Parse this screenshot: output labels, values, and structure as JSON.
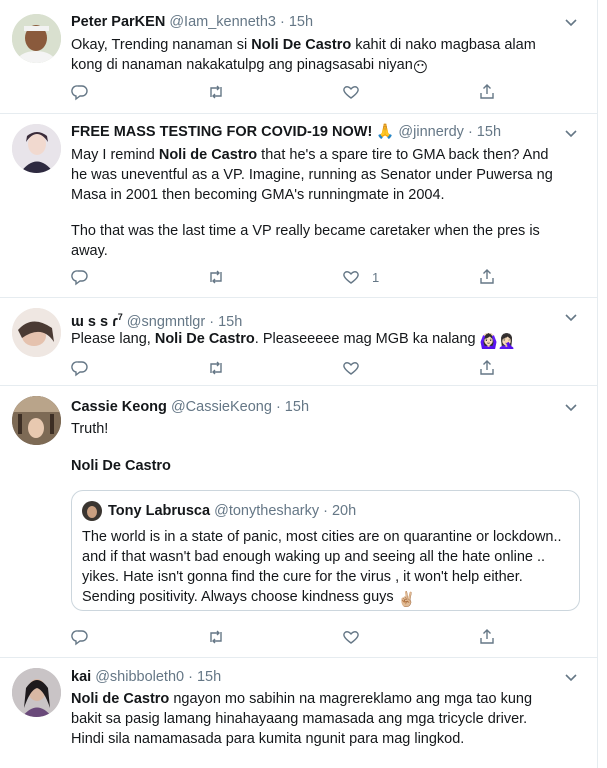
{
  "colors": {
    "text": "#14171a",
    "muted": "#657786",
    "border": "#e6ecf0",
    "quote_border": "#ccd6dd"
  },
  "icons": [
    "reply-icon",
    "retweet-icon",
    "like-icon",
    "share-icon",
    "chevron-down-icon"
  ],
  "tweets": [
    {
      "name": "Peter ParKEN",
      "handle": "@Iam_kenneth3",
      "time": "· 15h",
      "text_pre": "Okay, Trending nanaman si ",
      "text_bold": "Noli De Castro",
      "text_post": " kahit di nako magbasa alam kong di nanaman nakakatulpg ang pinagsasabi niyan",
      "emoji": "😶",
      "likes": ""
    },
    {
      "name": "FREE MASS TESTING FOR COVID-19 NOW!",
      "name_emoji": "🙏",
      "handle": "@jinnerdy",
      "time": "· 15h",
      "text_pre": "May I remind ",
      "text_bold": "Noli de Castro",
      "text_post": " that he's a spare tire to GMA back then? And he was uneventful as a VP. Imagine, running as Senator under Puwersa ng Masa in 2001 then becoming GMA's runningmate in 2004.",
      "text_extra": "Tho that was the last time a VP really became caretaker when the pres is away.",
      "likes": "1"
    },
    {
      "name": "ɯ s s ɾ",
      "name_sup": "7",
      "handle": "@sngmntlgr",
      "time": "· 15h",
      "text_pre": "Please lang, ",
      "text_bold": "Noli De Castro",
      "text_post": ". Pleaseeeee mag MGB ka nalang",
      "emoji": "🙆🏻‍♀️🤦🏻‍♀️",
      "likes": ""
    },
    {
      "name": "Cassie Keong",
      "handle": "@CassieKeong",
      "time": "· 15h",
      "text_pre": "Truth!",
      "text_bold": "Noli De Castro",
      "likes": "",
      "quote": {
        "name": "Tony Labrusca",
        "handle": "@tonythesharky",
        "time": "· 20h",
        "text": "The world is in a state of panic, most cities are on quarantine or lockdown.. and if that wasn't bad enough waking up and seeing all the hate online .. yikes. Hate isn't gonna find the cure for the virus , it won't help either. Sending positivity. Always choose kindness guys",
        "emoji": "✌🏼"
      }
    },
    {
      "name": "kai",
      "handle": "@shibboleth0",
      "time": "· 15h",
      "text_bold": "Noli de Castro",
      "text_post": " ngayon mo sabihin na magrereklamo ang mga tao kung bakit sa pasig lamang hinahayaang mamasada ang mga tricycle driver. Hindi sila namamasada para kumita ngunit para mag lingkod.",
      "likes": ""
    }
  ]
}
